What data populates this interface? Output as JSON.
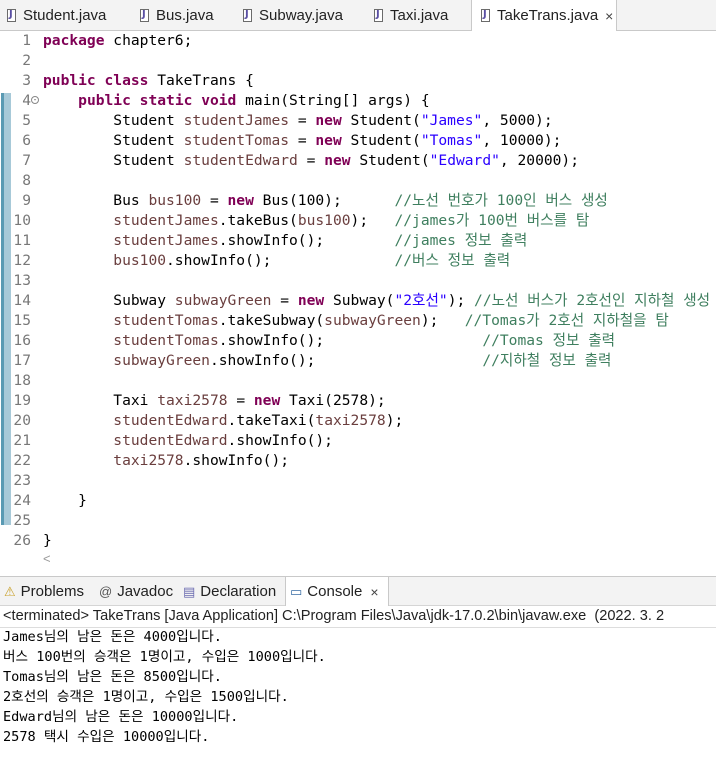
{
  "editor_tabs": [
    {
      "label": "Student.java",
      "active": false
    },
    {
      "label": "Bus.java",
      "active": false
    },
    {
      "label": "Subway.java",
      "active": false
    },
    {
      "label": "Taxi.java",
      "active": false
    },
    {
      "label": "TakeTrans.java",
      "active": true
    }
  ],
  "close_glyph": "×",
  "code_lines": [
    {
      "n": "1",
      "html": "<span class=\"kw\">package</span> chapter6;"
    },
    {
      "n": "2",
      "html": ""
    },
    {
      "n": "3",
      "html": "<span class=\"kw\">public</span> <span class=\"kw\">class</span> TakeTrans {"
    },
    {
      "n": "4",
      "html": "    <span class=\"kw\">public</span> <span class=\"kw\">static</span> <span class=\"kw\">void</span> main(String[] args) {"
    },
    {
      "n": "5",
      "html": "        Student <span class=\"var\">studentJames</span> = <span class=\"kw\">new</span> Student(<span class=\"str\">\"James\"</span>, 5000);"
    },
    {
      "n": "6",
      "html": "        Student <span class=\"var\">studentTomas</span> = <span class=\"kw\">new</span> Student(<span class=\"str\">\"Tomas\"</span>, 10000);"
    },
    {
      "n": "7",
      "html": "        Student <span class=\"var\">studentEdward</span> = <span class=\"kw\">new</span> Student(<span class=\"str\">\"Edward\"</span>, 20000);"
    },
    {
      "n": "8",
      "html": ""
    },
    {
      "n": "9",
      "html": "        Bus <span class=\"var\">bus100</span> = <span class=\"kw\">new</span> Bus(100);      <span class=\"cm\">//노선 번호가 100인 버스 생성</span>"
    },
    {
      "n": "10",
      "html": "        <span class=\"var\">studentJames</span>.takeBus(<span class=\"var\">bus100</span>);   <span class=\"cm\">//james가 100번 버스를 탐</span>"
    },
    {
      "n": "11",
      "html": "        <span class=\"var\">studentJames</span>.showInfo();        <span class=\"cm\">//james 정보 출력</span>"
    },
    {
      "n": "12",
      "html": "        <span class=\"var\">bus100</span>.showInfo();              <span class=\"cm\">//버스 정보 출력</span>"
    },
    {
      "n": "13",
      "html": ""
    },
    {
      "n": "14",
      "html": "        Subway <span class=\"var\">subwayGreen</span> = <span class=\"kw\">new</span> Subway(<span class=\"str\">\"2호선\"</span>); <span class=\"cm\">//노선 버스가 2호선인 지하철 생성</span>"
    },
    {
      "n": "15",
      "html": "        <span class=\"var\">studentTomas</span>.takeSubway(<span class=\"var\">subwayGreen</span>);   <span class=\"cm\">//Tomas가 2호선 지하철을 탐</span>"
    },
    {
      "n": "16",
      "html": "        <span class=\"var\">studentTomas</span>.showInfo();                  <span class=\"cm\">//Tomas 정보 출력</span>"
    },
    {
      "n": "17",
      "html": "        <span class=\"var\">subwayGreen</span>.showInfo();                   <span class=\"cm\">//지하철 정보 출력</span>"
    },
    {
      "n": "18",
      "html": ""
    },
    {
      "n": "19",
      "html": "        Taxi <span class=\"var\">taxi2578</span> = <span class=\"kw\">new</span> Taxi(2578);"
    },
    {
      "n": "20",
      "html": "        <span class=\"var\">studentEdward</span>.takeTaxi(<span class=\"var\">taxi2578</span>);"
    },
    {
      "n": "21",
      "html": "        <span class=\"var\">studentEdward</span>.showInfo();"
    },
    {
      "n": "22",
      "html": "        <span class=\"var\">taxi2578</span>.showInfo();"
    },
    {
      "n": "23",
      "html": ""
    },
    {
      "n": "24",
      "html": "    }"
    },
    {
      "n": "25",
      "html": ""
    },
    {
      "n": "26",
      "html": "}"
    }
  ],
  "panel_tabs": [
    {
      "label": "Problems",
      "icon": "problems-icon",
      "glyph": "⚠",
      "color": "#c9a12b",
      "active": false
    },
    {
      "label": "Javadoc",
      "icon": "javadoc-icon",
      "glyph": "@",
      "color": "#555555",
      "active": false
    },
    {
      "label": "Declaration",
      "icon": "declaration-icon",
      "glyph": "▤",
      "color": "#6b6bb0",
      "active": false
    },
    {
      "label": "Console",
      "icon": "console-icon",
      "glyph": "▭",
      "color": "#3a6ea5",
      "active": true
    }
  ],
  "console": {
    "status": "<terminated> TakeTrans [Java Application] C:\\Program Files\\Java\\jdk-17.0.2\\bin\\javaw.exe  (2022. 3. 2",
    "output": [
      "James님의 남은 돈은 4000입니다.",
      "버스 100번의 승객은 1명이고, 수입은 1000입니다.",
      "Tomas님의 남은 돈은 8500입니다.",
      "2호선의 승객은 1명이고, 수입은 1500입니다.",
      "Edward님의 남은 돈은 10000입니다.",
      "2578 택시 수입은 10000입니다."
    ]
  },
  "colors": {
    "keyword": "#7f0055",
    "variable": "#6a3e3e",
    "string": "#2a00ff",
    "comment": "#3f7f5f"
  }
}
